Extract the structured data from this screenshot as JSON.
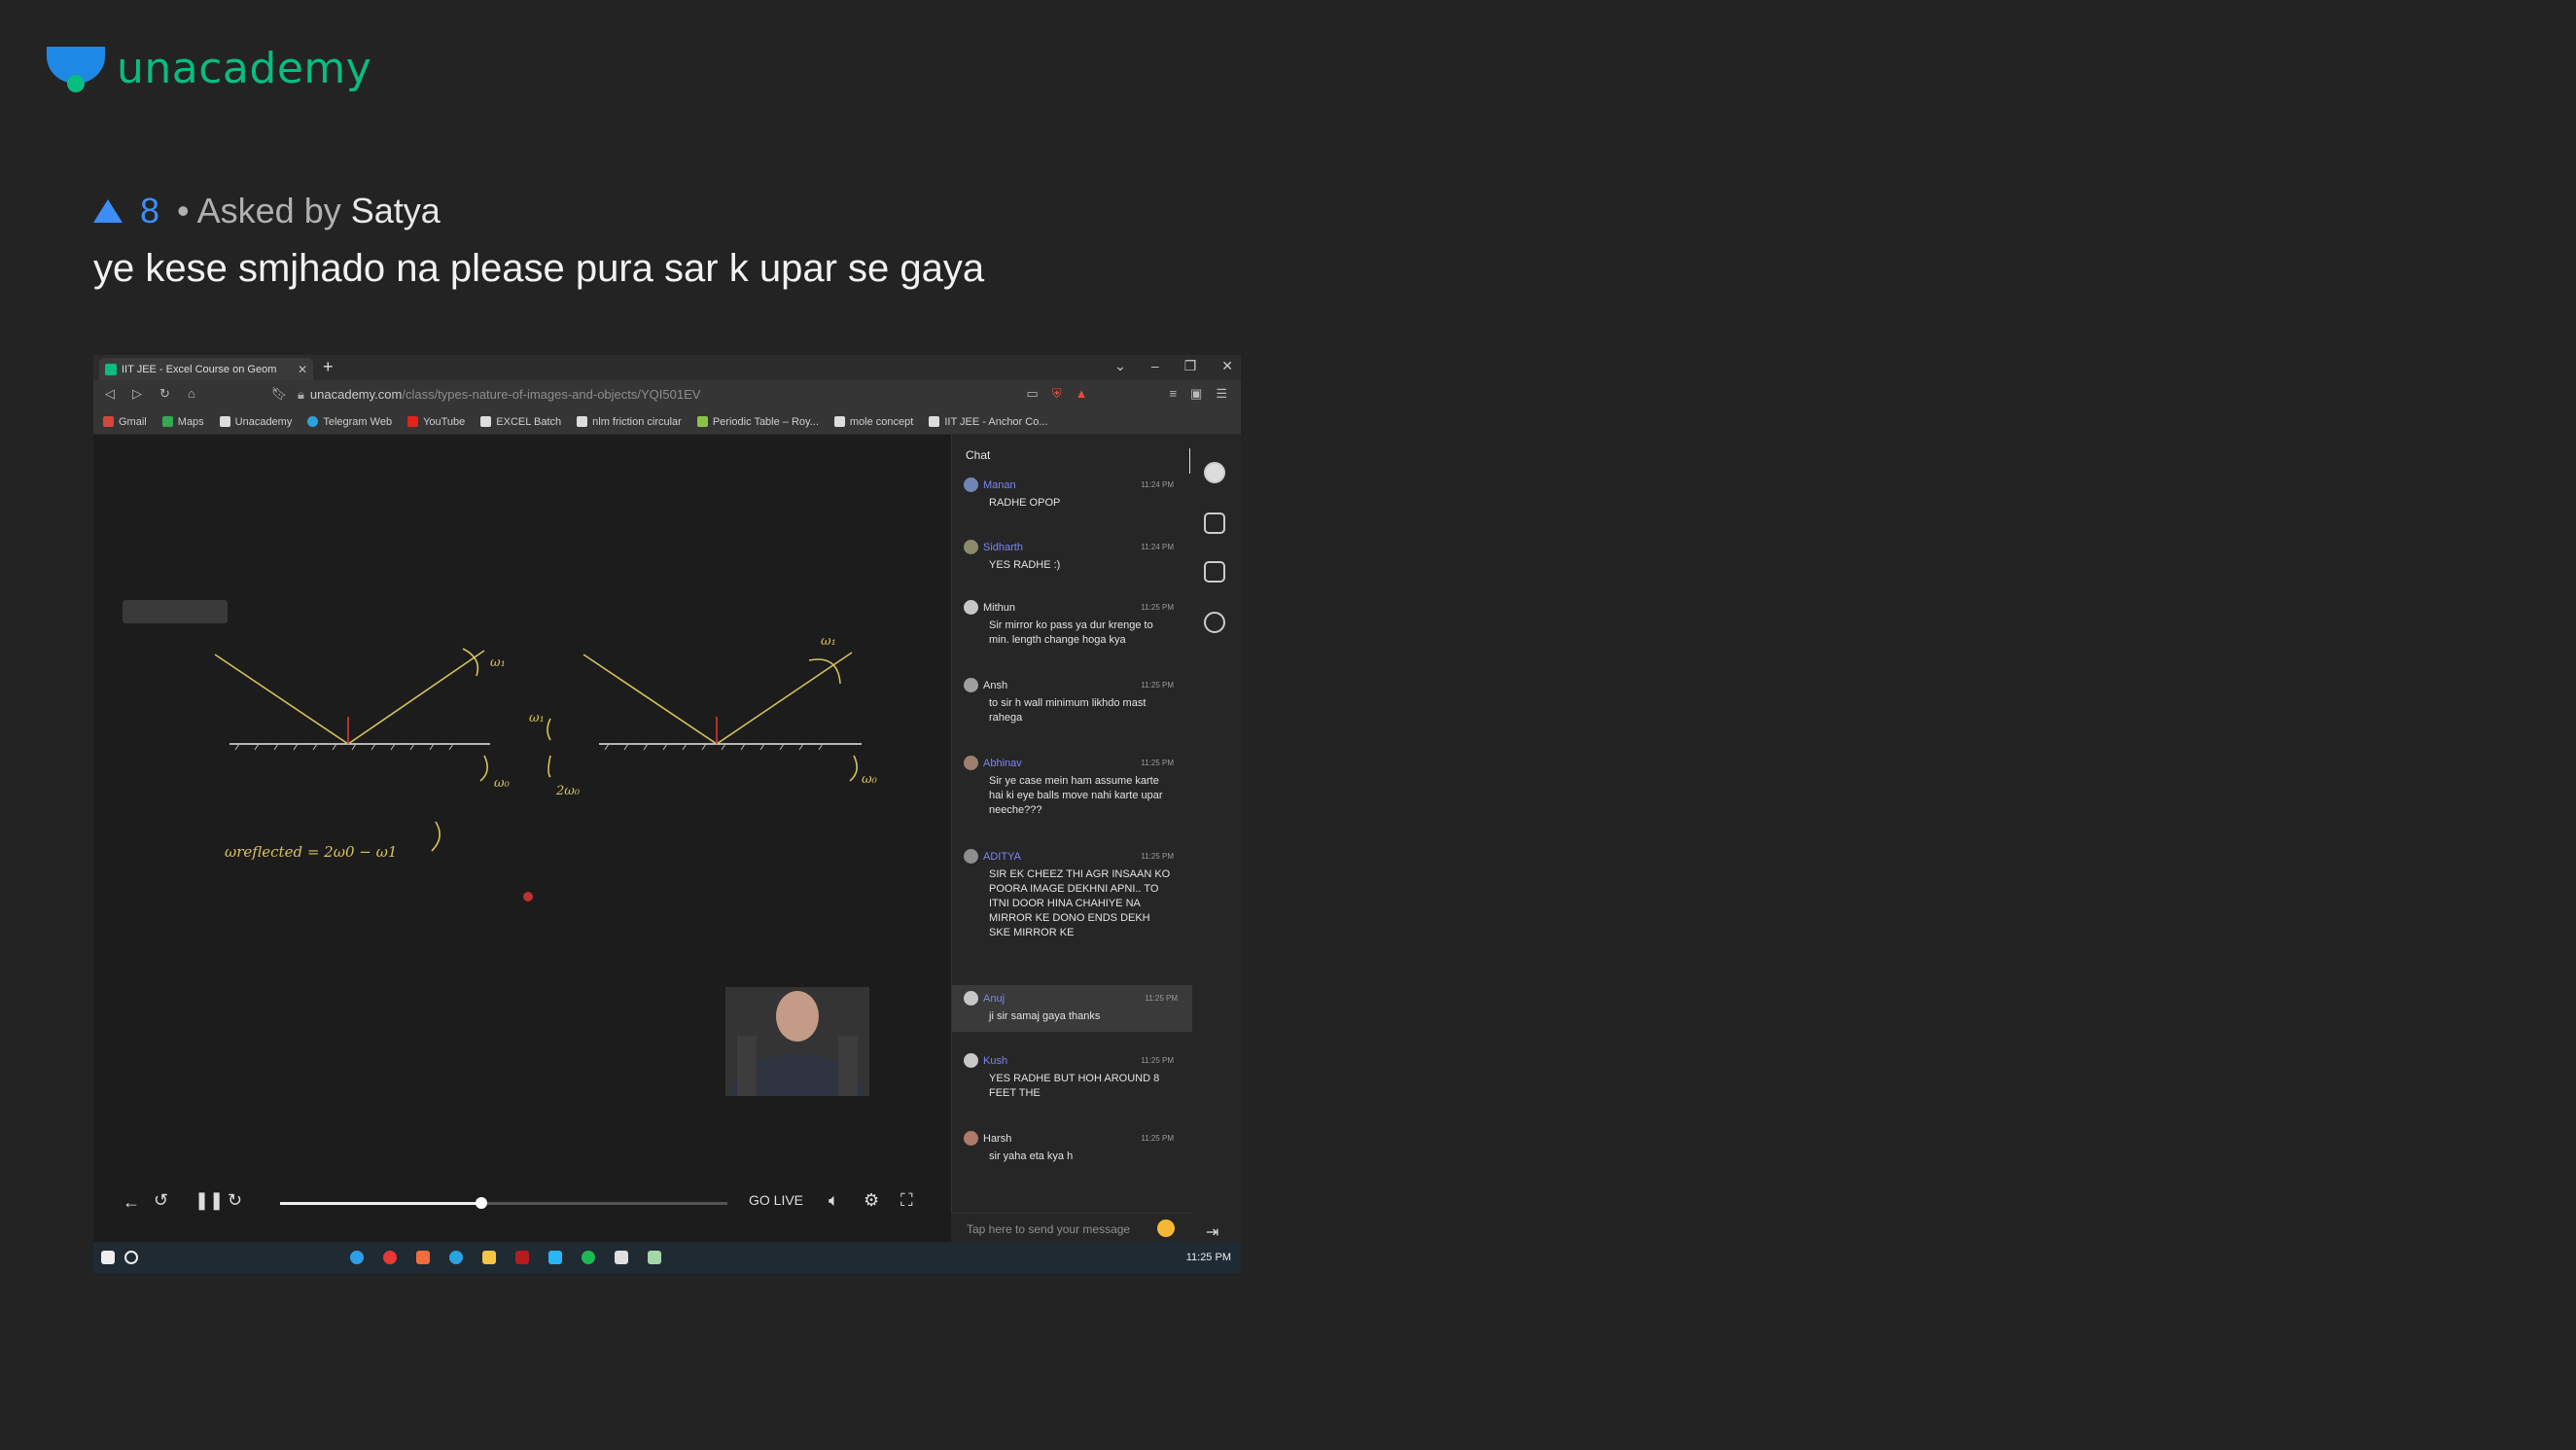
{
  "brand": {
    "name": "unacademy",
    "color": "#08bd80"
  },
  "question": {
    "upvotes": "8",
    "asked_by_label": "• Asked by",
    "asker": "Satya",
    "text": "ye kese smjhado na please pura sar k upar se gaya"
  },
  "browser": {
    "tab_title": "IIT JEE - Excel Course on Geom",
    "url_host": "unacademy.com",
    "url_path": "/class/types-nature-of-images-and-objects/YQI501EV",
    "bookmarks": [
      "Gmail",
      "Maps",
      "Unacademy",
      "Telegram Web",
      "YouTube",
      "EXCEL Batch",
      "nlm friction circular",
      "Periodic Table – Roy...",
      "mole concept",
      "IIT JEE - Anchor Co..."
    ]
  },
  "player": {
    "go_live_label": "GO LIVE",
    "progress": 0.45,
    "whiteboard_equation": "ωreflected = 2ω0 − ω1"
  },
  "chat": {
    "title": "Chat",
    "input_placeholder": "Tap here to send your message",
    "messages": [
      {
        "name": "Manan",
        "plus": true,
        "time": "11:24 PM",
        "text": "RADHE OPOP"
      },
      {
        "name": "Sidharth",
        "plus": true,
        "time": "11:24 PM",
        "text": "YES RADHE :)"
      },
      {
        "name": "Mithun",
        "plus": false,
        "time": "11:25 PM",
        "text": "Sir mirror ko pass ya dur krenge to min. length change hoga kya"
      },
      {
        "name": "Ansh",
        "plus": false,
        "time": "11:25 PM",
        "text": "to sir h wall minimum likhdo mast rahega"
      },
      {
        "name": "Abhinav",
        "plus": true,
        "time": "11:25 PM",
        "text": "Sir ye case mein ham assume karte hai ki eye balls move nahi karte upar neeche???"
      },
      {
        "name": "ADITYA",
        "plus": true,
        "time": "11:25 PM",
        "text": "SIR EK CHEEZ THI AGR INSAAN KO POORA IMAGE DEKHNI APNI.. TO ITNI DOOR HINA CHAHIYE NA MIRROR KE DONO ENDS DEKH SKE MIRROR KE"
      },
      {
        "name": "Anuj",
        "plus": true,
        "time": "11:25 PM",
        "text": "ji sir samaj gaya thanks"
      },
      {
        "name": "Kush",
        "plus": true,
        "time": "11:25 PM",
        "text": "YES RADHE BUT HOH AROUND 8 FEET THE"
      },
      {
        "name": "Harsh",
        "plus": false,
        "time": "11:25 PM",
        "text": "sir yaha eta kya h"
      }
    ]
  },
  "taskbar": {
    "time": "11:25 PM"
  }
}
